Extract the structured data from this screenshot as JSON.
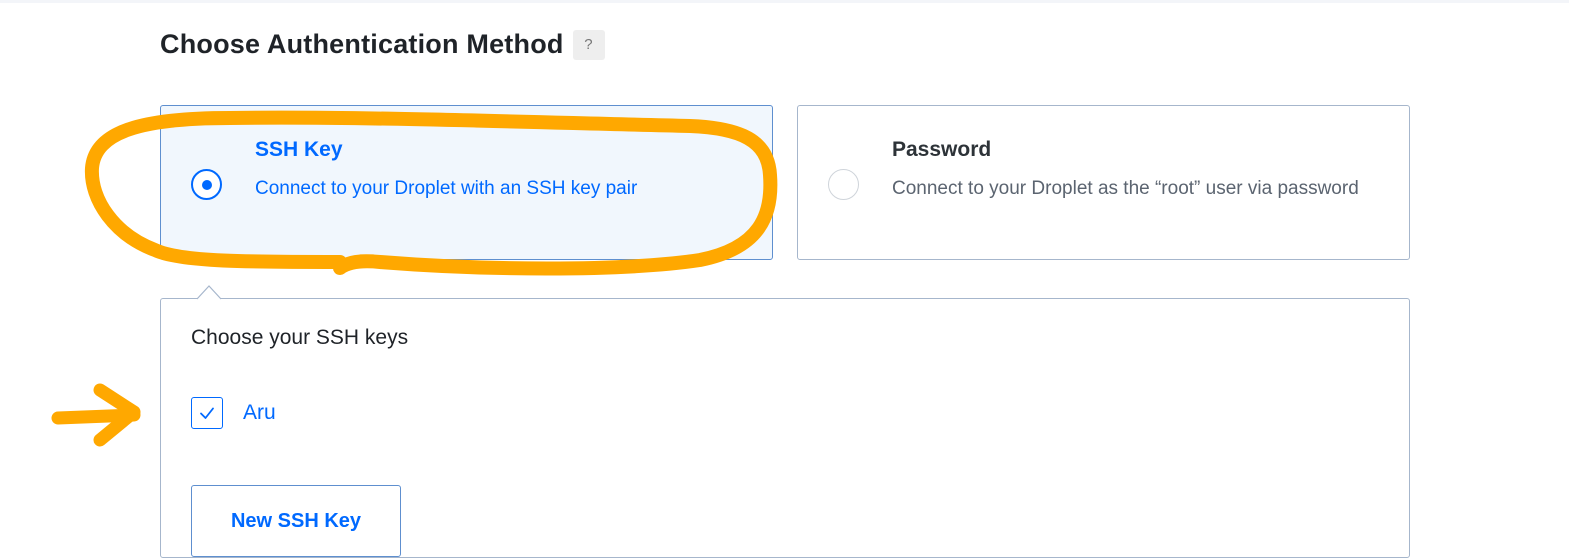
{
  "section": {
    "title": "Choose Authentication Method",
    "help_label": "?"
  },
  "auth_options": [
    {
      "title": "SSH Key",
      "description": "Connect to your Droplet with an SSH key pair",
      "selected": true
    },
    {
      "title": "Password",
      "description": "Connect to your Droplet as the “root” user via password",
      "selected": false
    }
  ],
  "ssh_keys": {
    "heading": "Choose your SSH keys",
    "keys": [
      {
        "name": "Aru",
        "checked": true
      }
    ],
    "new_key_label": "New SSH Key"
  },
  "annotations": {
    "highlight_color": "#ffa800",
    "marks": [
      "highlight-circle-around-ssh-key-option",
      "arrow-pointing-to-aru-key"
    ]
  },
  "colors": {
    "accent": "#0069ff",
    "selected_bg": "#f1f7fd",
    "border": "#a6b6cc"
  }
}
